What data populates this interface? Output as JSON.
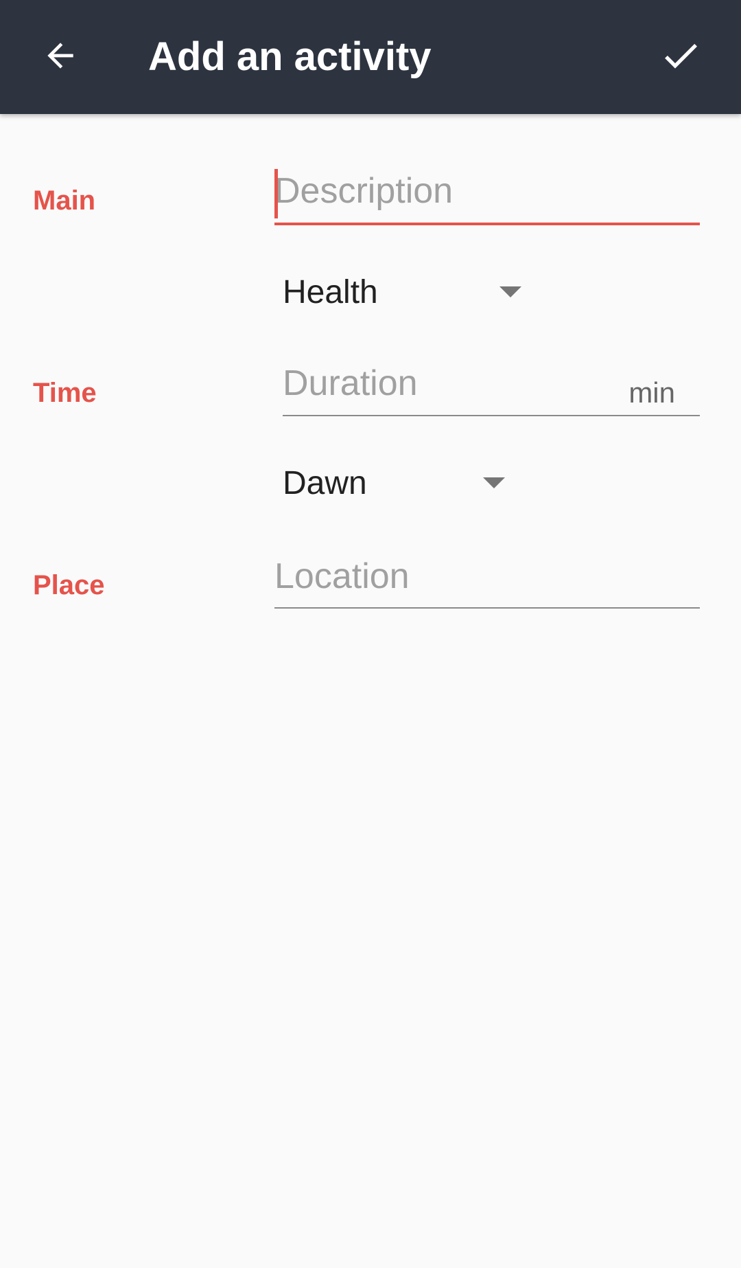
{
  "toolbar": {
    "title": "Add an activity",
    "back_icon": "arrow-back-icon",
    "confirm_icon": "check-icon"
  },
  "colors": {
    "toolbar_bg": "#2d3440",
    "accent": "#e5534b",
    "background": "#fafafa"
  },
  "form": {
    "main": {
      "label": "Main",
      "description": {
        "value": "",
        "placeholder": "Description"
      },
      "category": {
        "selected": "Health"
      }
    },
    "time": {
      "label": "Time",
      "duration": {
        "value": "",
        "placeholder": "Duration",
        "unit": "min"
      },
      "time_of_day": {
        "selected": "Dawn"
      }
    },
    "place": {
      "label": "Place",
      "location": {
        "value": "",
        "placeholder": "Location"
      }
    }
  }
}
